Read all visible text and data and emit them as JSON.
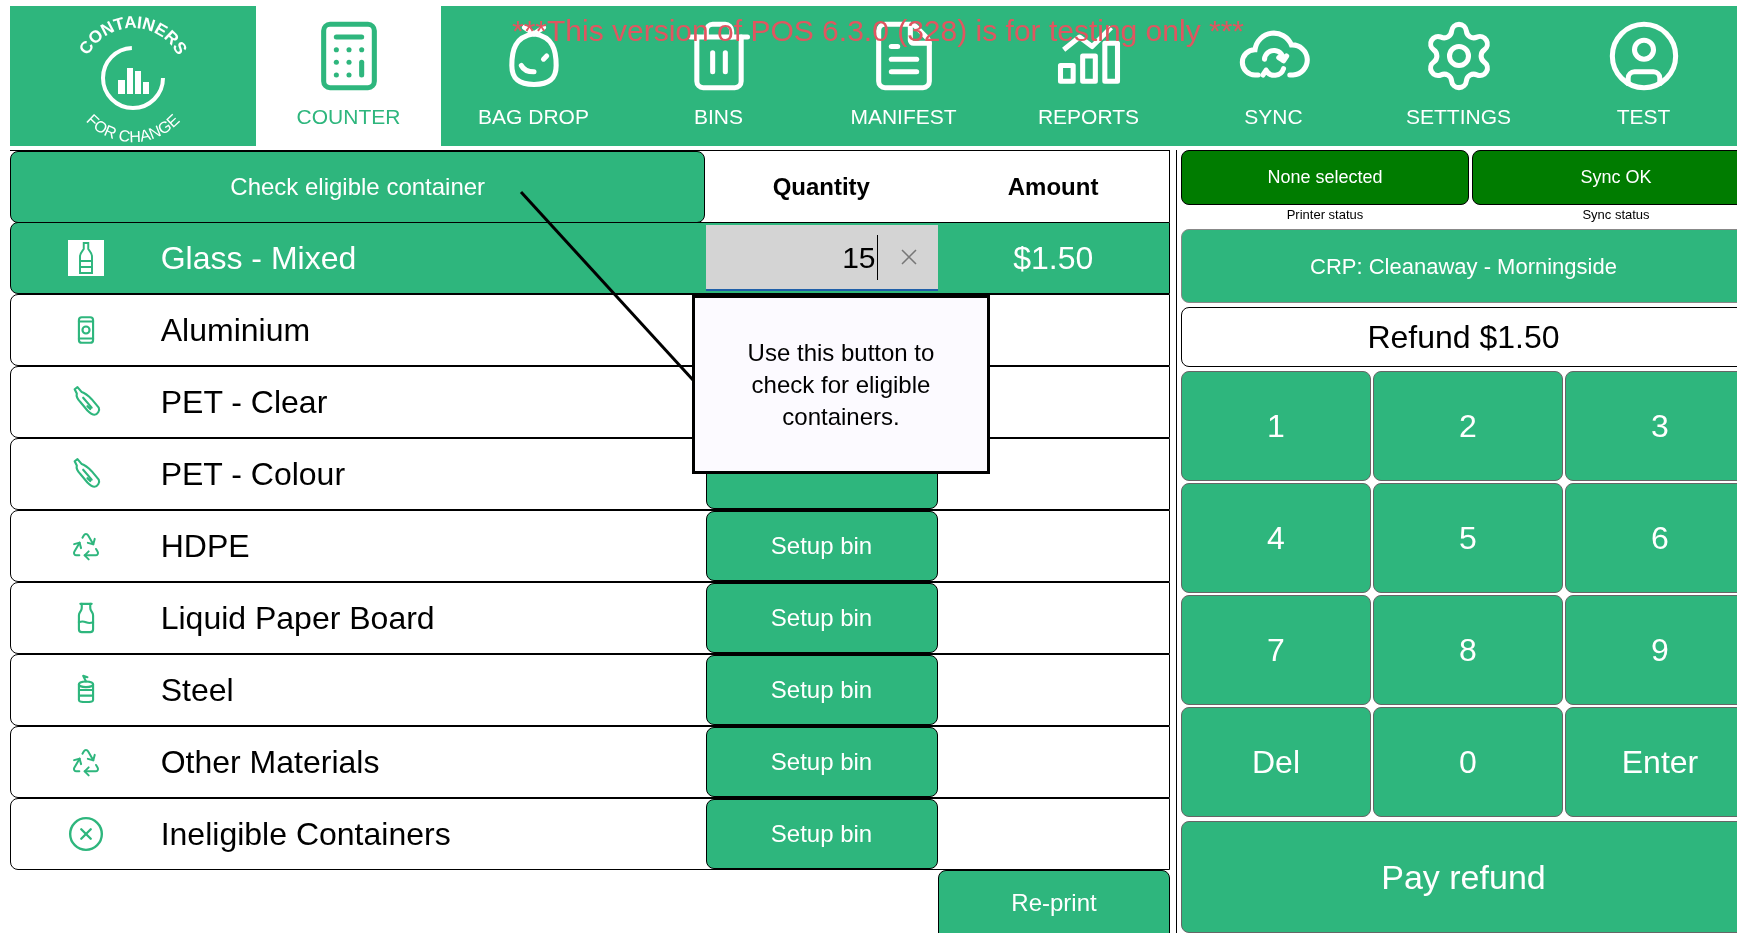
{
  "logo": {
    "text_top": "CONTAINERS",
    "text_bottom": "FOR CHANGE"
  },
  "tabs": [
    {
      "label": "COUNTER",
      "kind": "register",
      "selected": true
    },
    {
      "label": "BAG DROP",
      "kind": "bag",
      "selected": false
    },
    {
      "label": "BINS",
      "kind": "bin",
      "selected": false
    },
    {
      "label": "MANIFEST",
      "kind": "manifest",
      "selected": false
    },
    {
      "label": "REPORTS",
      "kind": "chart",
      "selected": false
    },
    {
      "label": "SYNC",
      "kind": "sync",
      "selected": false
    },
    {
      "label": "SETTINGS",
      "kind": "gear",
      "selected": false
    },
    {
      "label": "TEST",
      "kind": "user",
      "selected": false
    }
  ],
  "banner": "***This version of POS 6.3.0 (328) is for testing only ***",
  "check_button": "Check eligible container",
  "columns": [
    "Quantity",
    "Amount"
  ],
  "rows": [
    {
      "name": "Glass - Mixed",
      "kind": "glass",
      "selected": true,
      "quantity": "15",
      "amount": "$1.50"
    },
    {
      "name": "Aluminium",
      "kind": "can",
      "selected": false
    },
    {
      "name": "PET - Clear",
      "kind": "pet",
      "selected": false
    },
    {
      "name": "PET - Colour",
      "kind": "pet",
      "selected": false,
      "covered_button": true
    },
    {
      "name": "HDPE",
      "kind": "recycle",
      "selected": false,
      "action": "Setup bin"
    },
    {
      "name": "Liquid Paper Board",
      "kind": "carton",
      "selected": false,
      "action": "Setup bin"
    },
    {
      "name": "Steel",
      "kind": "tin",
      "selected": false,
      "action": "Setup bin"
    },
    {
      "name": "Other Materials",
      "kind": "recycle",
      "selected": false,
      "action": "Setup bin"
    },
    {
      "name": "Ineligible Containers",
      "kind": "cross",
      "selected": false,
      "action": "Setup bin"
    }
  ],
  "reprint_button": "Re-print",
  "tooltip": "Use this button to check for eligible containers.",
  "statuses": [
    {
      "value": "None selected",
      "label": "Printer status"
    },
    {
      "value": "Sync OK",
      "label": "Sync status"
    }
  ],
  "crp_button": "CRP: Cleanaway - Morningside",
  "refund": "Refund $1.50",
  "keypad": [
    "1",
    "2",
    "3",
    "4",
    "5",
    "6",
    "7",
    "8",
    "9",
    "Del",
    "0",
    "Enter"
  ],
  "pay_button": "Pay refund"
}
